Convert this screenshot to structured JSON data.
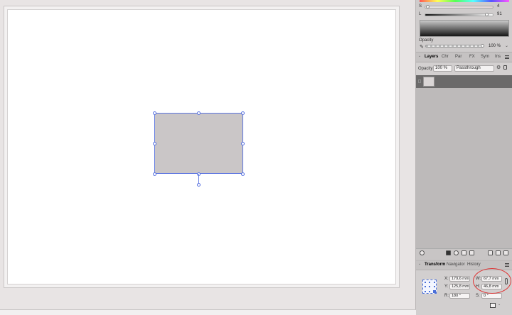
{
  "color_panel": {
    "s_label": "S",
    "s_value": "4",
    "l_label": "L",
    "l_value": "91",
    "opacity_label": "Opacity",
    "opacity_value": "100 %"
  },
  "layers_tabs": [
    {
      "label": "Layers",
      "active": true
    },
    {
      "label": "Chr",
      "active": false
    },
    {
      "label": "Par",
      "active": false
    },
    {
      "label": "FX",
      "active": false
    },
    {
      "label": "Sym",
      "active": false
    },
    {
      "label": "Ins",
      "active": false
    }
  ],
  "layers_toolbar": {
    "opacity_label": "Opacity:",
    "opacity_value": "100 %",
    "blend_mode": "Passthrough"
  },
  "transform_tabs": [
    {
      "label": "Transform",
      "active": true
    },
    {
      "label": "Navigator",
      "active": false
    },
    {
      "label": "History",
      "active": false
    }
  ],
  "transform": {
    "x_label": "X:",
    "x_value": "179,6 mm",
    "y_label": "Y:",
    "y_value": "125,8 mm",
    "w_label": "W:",
    "w_value": "67,7 mm",
    "h_label": "H:",
    "h_value": "46,8 mm",
    "r_label": "R:",
    "r_value": "180 °",
    "s_label": "S:",
    "s_value": "0 °"
  },
  "colors": {
    "selection": "#5b74e0",
    "shape_fill": "#cac6c7",
    "annotation": "#e03434"
  }
}
